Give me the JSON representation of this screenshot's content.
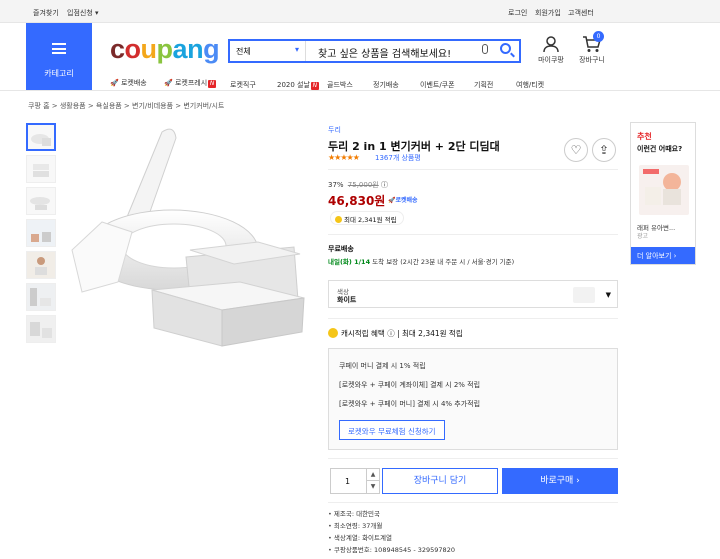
{
  "topbar": {
    "favorites": "즐겨찾기",
    "seller": "입점신청 ▾",
    "login": "로그인",
    "signup": "회원가입",
    "support": "고객센터"
  },
  "header": {
    "category_label": "카테고리",
    "logo_letters": [
      "c",
      "o",
      "u",
      "p",
      "a",
      "n",
      "g"
    ],
    "logo_colors": [
      "#7b2a2a",
      "#d22e2e",
      "#f3a71b",
      "#8ac43f",
      "#1aa3de",
      "#1aa3de",
      "#4b8bf5"
    ],
    "search_category": "전체",
    "search_placeholder": "찾고 싶은 상품을 검색해보세요!",
    "mypage": "마이쿠팡",
    "cart": "장바구니",
    "cart_count": "0"
  },
  "nav": [
    "로켓배송",
    "로켓프레시",
    "로켓직구",
    "2020 설날",
    "골드박스",
    "정기배송",
    "이벤트/쿠폰",
    "기획전",
    "여행/티켓"
  ],
  "breadcrumb": "쿠팡 홈  >  생활용품  >  욕실용품  >  변기/비데용품  >  변기커버/시트",
  "product": {
    "brand": "두리",
    "title": "두리 2 in 1 변기커버 + 2단 디딤대",
    "stars": "★★★★★",
    "reviews": "1367개 상품평",
    "discount_rate": "37%",
    "original_price": "75,000원",
    "price": "46,830원",
    "rocket": "🚀로켓배송",
    "cash_badge": "최대 2,341원 적립",
    "shipping_title": "무료배송",
    "shipping_date": "내일(화) 1/14",
    "shipping_note": "도착 보장 (2시간 23분 내 주문 시 / 서울·경기 기준)",
    "option_label": "색상",
    "option_value": "화이트",
    "cash_title": "캐시적립 혜택",
    "cash_value": "최대 2,341원 적립",
    "benefits": [
      "쿠페이 머니 결제 시 1% 적립",
      "[로켓와우 + 쿠페이 계좌이체] 결제 시 2% 적립",
      "[로켓와우 + 쿠페이 머니] 결제 시 4% 추가적립"
    ],
    "benefit_button": "로켓와우 무료체험 신청하기",
    "quantity": "1",
    "cart_button": "장바구니 담기",
    "buy_button": "바로구매 ›",
    "specs": [
      "제조국: 대한민국",
      "최소연령: 37개월",
      "색상계열: 화이트계열",
      "쿠팡상품번호: 108948545 - 329597820"
    ]
  },
  "side": {
    "title": "추천",
    "subtitle": "이런건 어때요?",
    "item": "래퍼 유아변...",
    "item2": "광고",
    "more": "더 알아보기 ›"
  }
}
